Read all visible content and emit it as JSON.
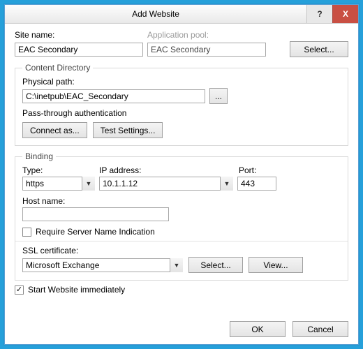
{
  "titlebar": {
    "title": "Add Website",
    "help": "?",
    "close": "X"
  },
  "labels": {
    "site_name": "Site name:",
    "app_pool": "Application pool:",
    "select_btn": "Select...",
    "content_directory": "Content Directory",
    "physical_path": "Physical path:",
    "browse_btn": "...",
    "pass_through": "Pass-through authentication",
    "connect_as": "Connect as...",
    "test_settings": "Test Settings...",
    "binding": "Binding",
    "type": "Type:",
    "ip_address": "IP address:",
    "port": "Port:",
    "host_name": "Host name:",
    "require_sni": "Require Server Name Indication",
    "ssl_certificate": "SSL certificate:",
    "view_btn": "View...",
    "start_immediately": "Start Website immediately",
    "ok": "OK",
    "cancel": "Cancel"
  },
  "values": {
    "site_name": "EAC Secondary",
    "app_pool": "EAC Secondary",
    "physical_path": "C:\\inetpub\\EAC_Secondary",
    "type": "https",
    "ip_address": "10.1.1.12",
    "port": "443",
    "host_name": "",
    "require_sni_checked": false,
    "ssl_certificate": "Microsoft Exchange",
    "start_immediately_checked": true,
    "check_glyph": "✓"
  }
}
